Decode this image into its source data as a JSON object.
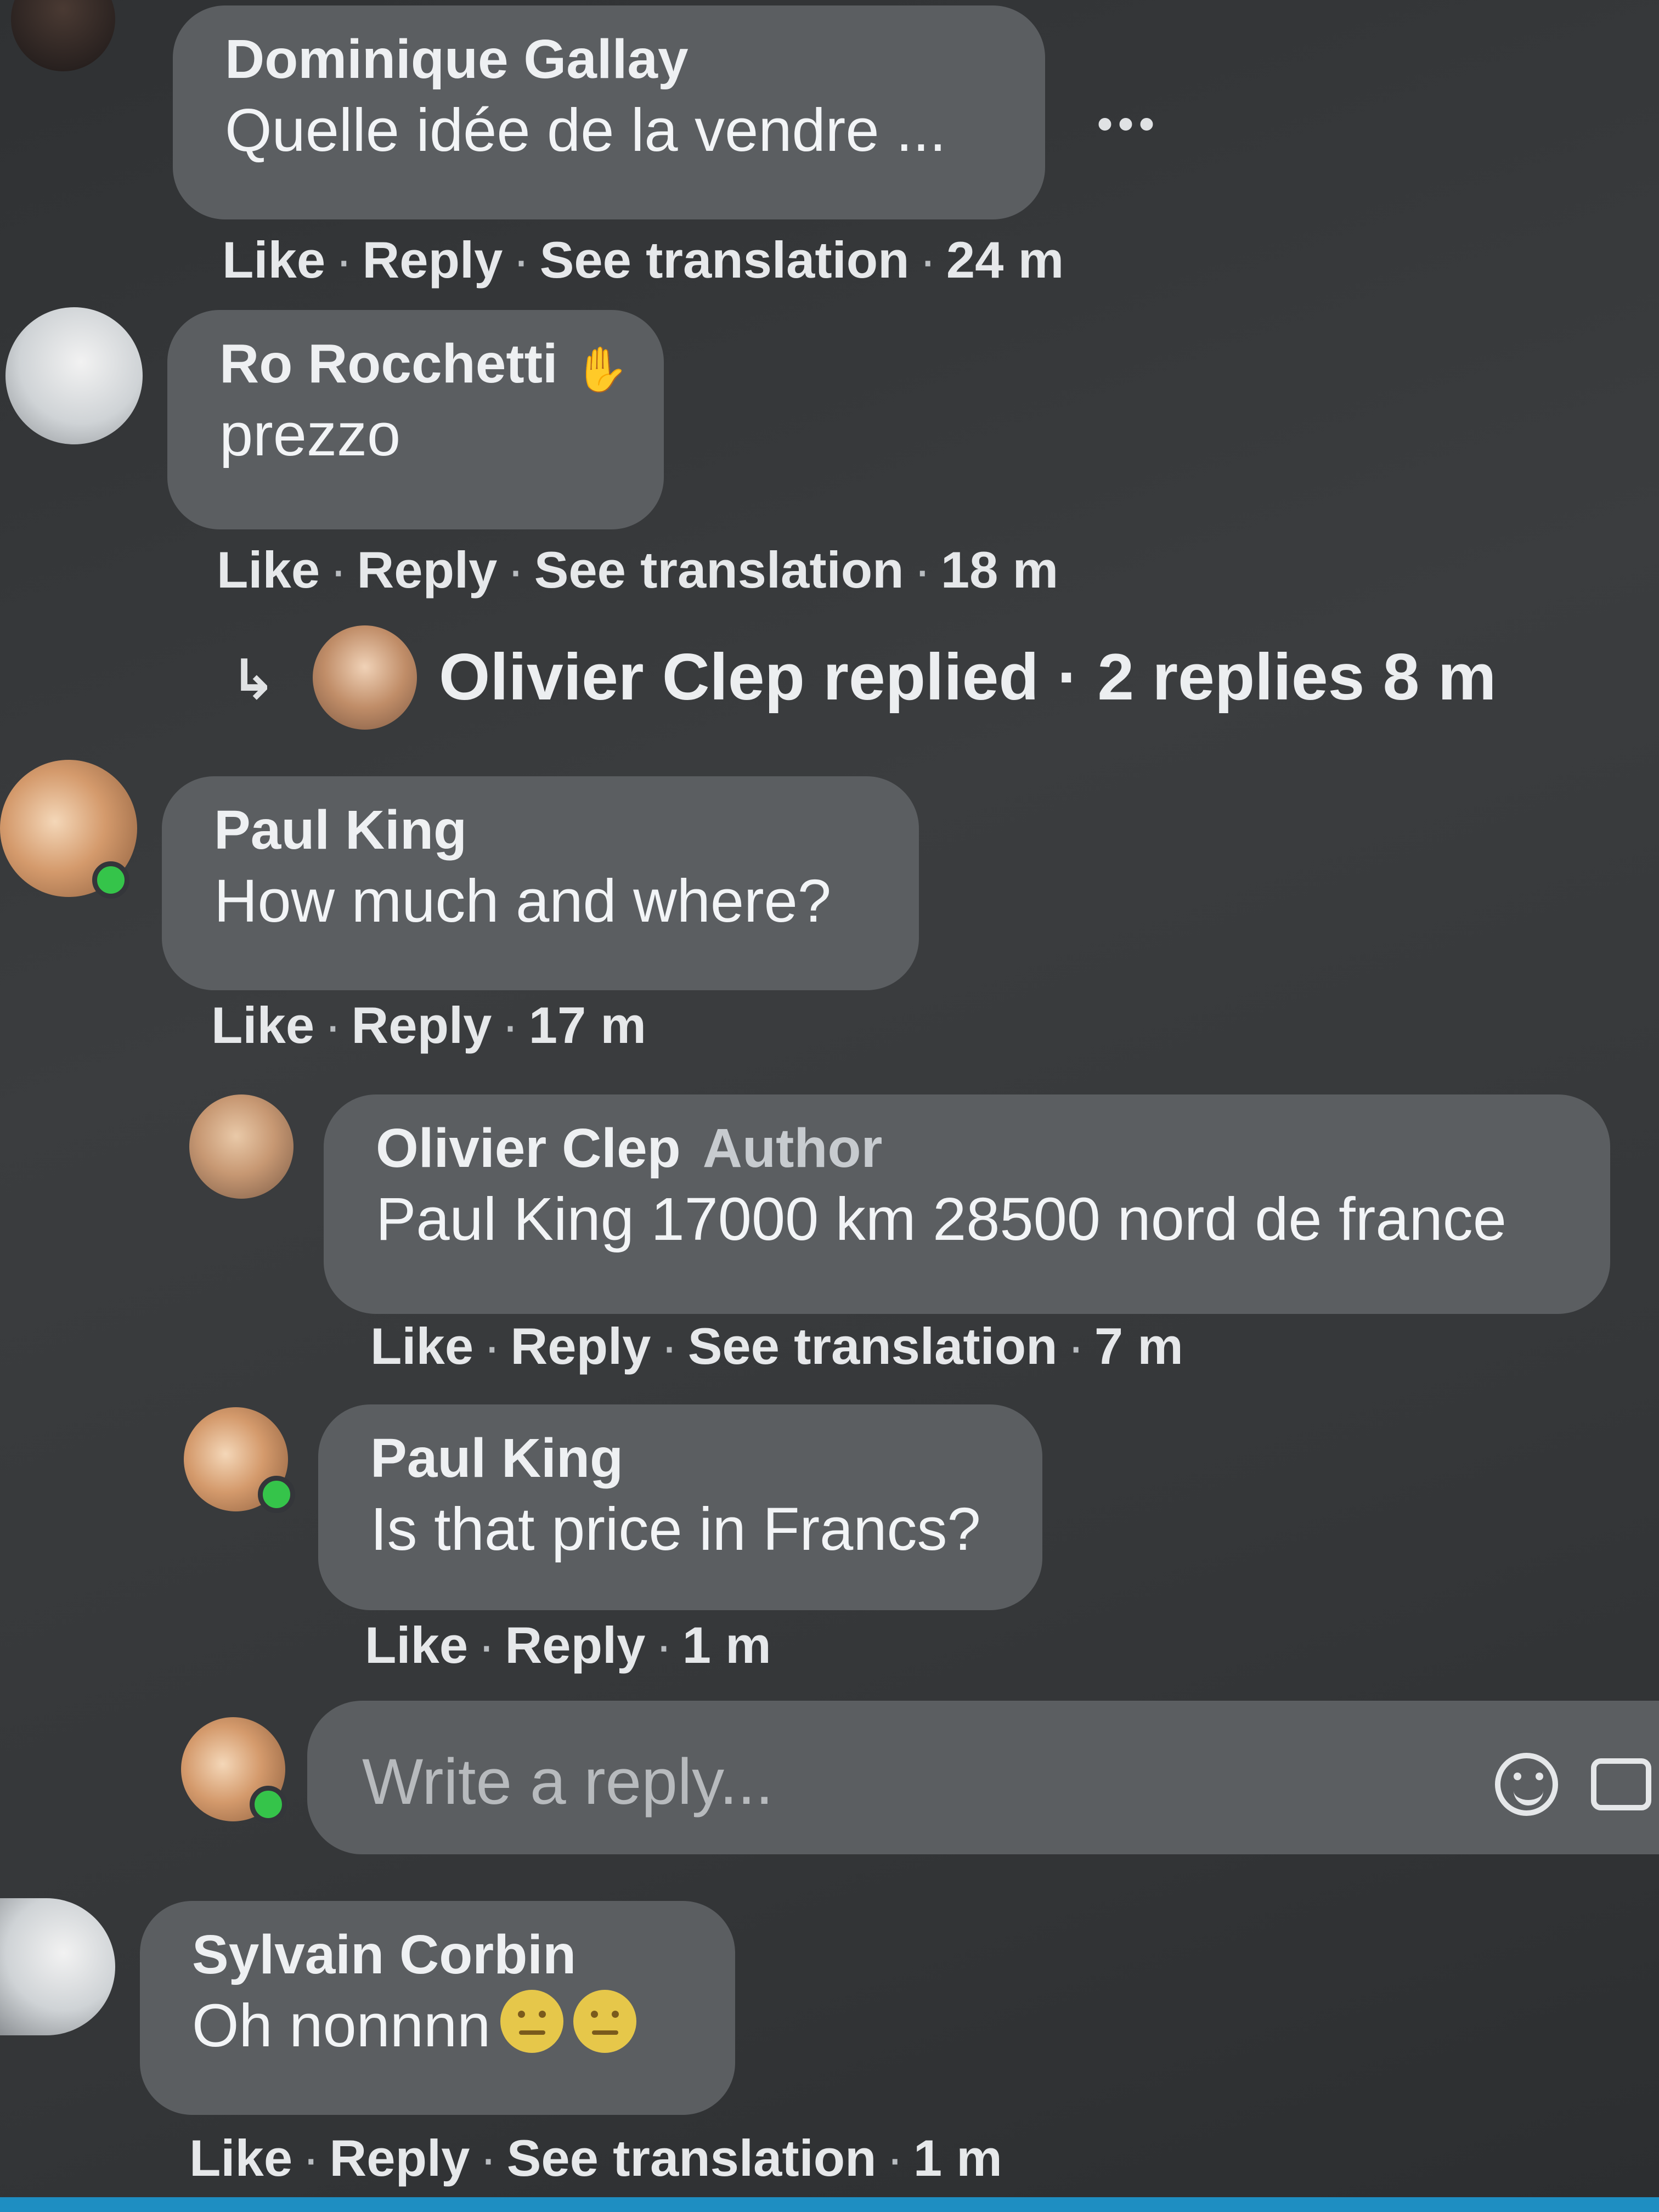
{
  "comments": [
    {
      "author": "Dominique Gallay",
      "text": "Quelle idée de la vendre ...",
      "actions": {
        "like": "Like",
        "reply": "Reply",
        "translate": "See translation",
        "time": "24 m"
      }
    },
    {
      "author": "Ro Rocchetti",
      "text": "prezzo",
      "actions": {
        "like": "Like",
        "reply": "Reply",
        "translate": "See translation",
        "time": "18 m"
      },
      "replies_summary": {
        "text": "Olivier Clep replied · 2 replies 8 m"
      }
    },
    {
      "author": "Paul King",
      "text": "How much and where?",
      "actions": {
        "like": "Like",
        "reply": "Reply",
        "time": "17 m"
      },
      "replies": [
        {
          "author": "Olivier Clep",
          "badge": "Author",
          "text": "Paul King 17000 km 28500 nord de france",
          "actions": {
            "like": "Like",
            "reply": "Reply",
            "translate": "See translation",
            "time": "7 m"
          }
        },
        {
          "author": "Paul King",
          "text": "Is that price in Francs?",
          "actions": {
            "like": "Like",
            "reply": "Reply",
            "time": "1 m"
          }
        }
      ],
      "reply_box": {
        "placeholder": "Write a reply..."
      }
    },
    {
      "author": "Sylvain Corbin",
      "text": "Oh nonnnn",
      "actions": {
        "like": "Like",
        "reply": "Reply",
        "translate": "See translation",
        "time": "1 m"
      }
    }
  ],
  "more_menu": "•••",
  "separator": "·",
  "icons": [
    "wave-hand-icon",
    "reply-arrow-icon",
    "emoji-icon",
    "camera-icon",
    "neutral-face-emoji"
  ],
  "colors": {
    "online_dot": "#35c44a",
    "bubble": "#5b5e61",
    "background": "#353739"
  }
}
